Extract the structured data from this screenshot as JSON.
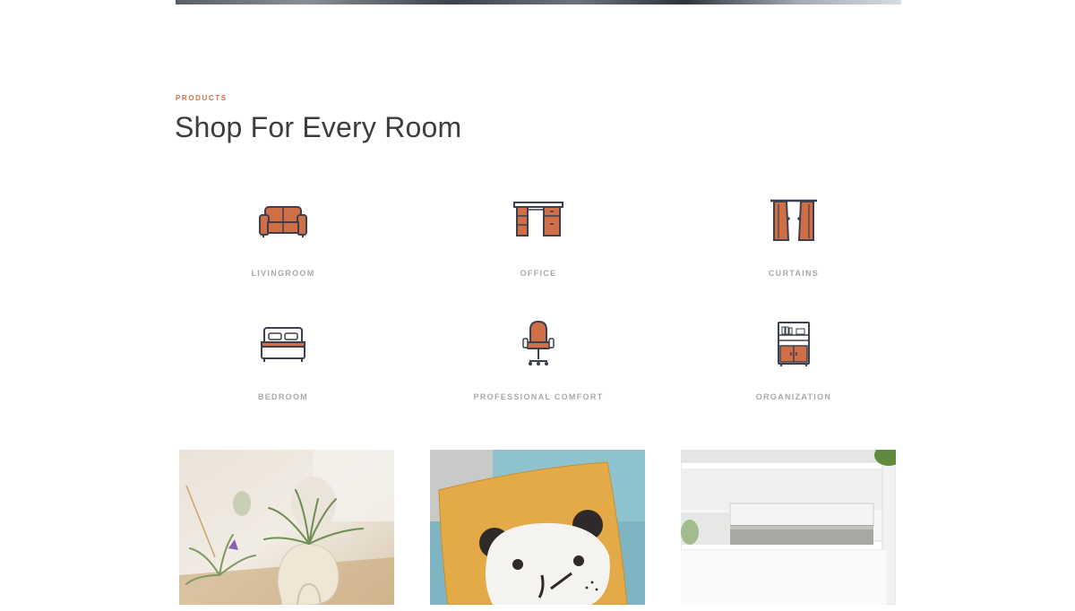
{
  "section": {
    "eyebrow": "PRODUCTS",
    "title": "Shop For Every Room"
  },
  "categories": [
    {
      "label": "LIVINGROOM",
      "icon": "sofa-icon"
    },
    {
      "label": "OFFICE",
      "icon": "desk-icon"
    },
    {
      "label": "CURTAINS",
      "icon": "curtains-icon"
    },
    {
      "label": "BEDROOM",
      "icon": "bed-icon"
    },
    {
      "label": "PROFESSIONAL COMFORT",
      "icon": "office-chair-icon"
    },
    {
      "label": "ORGANIZATION",
      "icon": "bookcase-icon"
    }
  ],
  "colors": {
    "accent": "#d06f45",
    "icon_outline": "#3b3f4e",
    "label": "#a8a8a8"
  }
}
